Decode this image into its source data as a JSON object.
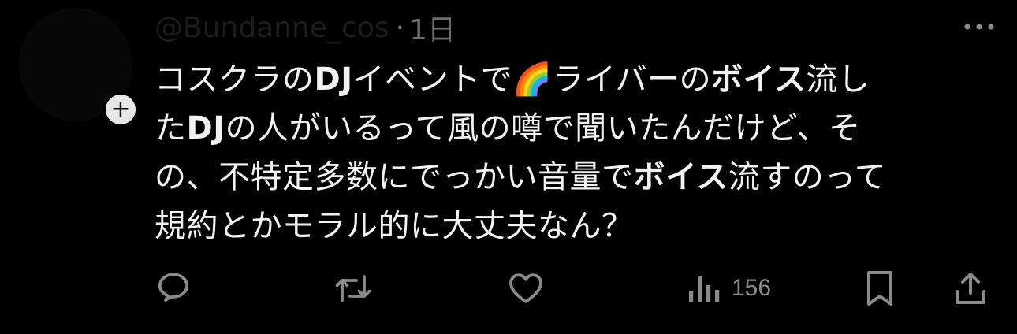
{
  "post": {
    "username": "@Bundanne_cos",
    "separator": "·",
    "time": "1日",
    "text": {
      "s1": "コスクラの",
      "s2": "DJ",
      "s3": "イベントで",
      "emoji": "🌈",
      "s4": "ライバーの",
      "s5": "ボイス",
      "s6": "流し",
      "s7": "た",
      "s8": "DJ",
      "s9": "の人がいるって風の噂で聞いたんだけど、そ",
      "s10": "の、不特定多数にでっかい音量で",
      "s11": "ボイス",
      "s12": "流すのって",
      "s13": "規約とかモラル的に大丈夫なん？"
    },
    "follow_symbol": "+"
  },
  "actions": {
    "views_count": "156"
  },
  "icons": {
    "reply": "reply-icon",
    "repost": "repost-icon",
    "like": "heart-icon",
    "views": "views-icon",
    "bookmark": "bookmark-icon",
    "share": "share-icon",
    "more": "more-icon"
  },
  "colors": {
    "background": "#000000",
    "text": "#f2f2f2",
    "muted": "#8a8a8a"
  }
}
